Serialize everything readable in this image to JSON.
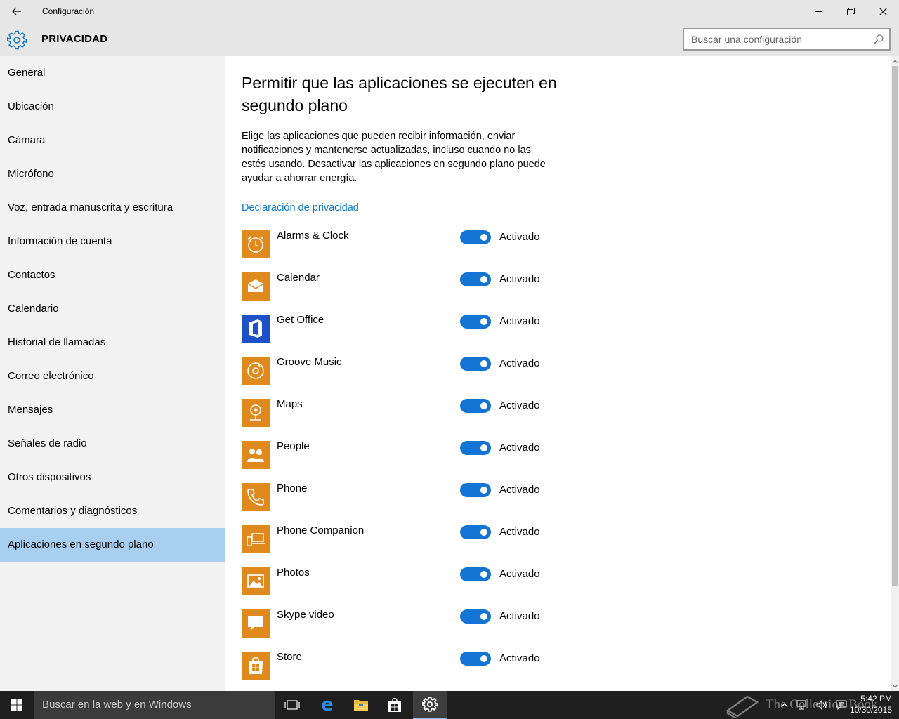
{
  "window": {
    "title": "Configuración"
  },
  "header": {
    "title": "PRIVACIDAD",
    "search_placeholder": "Buscar una configuración"
  },
  "sidebar": {
    "items": [
      {
        "label": "General"
      },
      {
        "label": "Ubicación"
      },
      {
        "label": "Cámara"
      },
      {
        "label": "Micrófono"
      },
      {
        "label": "Voz, entrada manuscrita y escritura"
      },
      {
        "label": "Información de cuenta"
      },
      {
        "label": "Contactos"
      },
      {
        "label": "Calendario"
      },
      {
        "label": "Historial de llamadas"
      },
      {
        "label": "Correo electrónico"
      },
      {
        "label": "Mensajes"
      },
      {
        "label": "Señales de radio"
      },
      {
        "label": "Otros dispositivos"
      },
      {
        "label": "Comentarios y diagnósticos"
      },
      {
        "label": "Aplicaciones en segundo plano",
        "selected": true
      }
    ]
  },
  "main": {
    "title": "Permitir que las aplicaciones se ejecuten en segundo plano",
    "description": "Elige las aplicaciones que pueden recibir información, enviar notificaciones y mantenerse actualizadas, incluso cuando no las estés usando. Desactivar las aplicaciones en segundo plano puede ayudar a ahorrar energía.",
    "privacy_link": "Declaración de privacidad",
    "apps": [
      {
        "name": "Alarms & Clock",
        "state": "Activado",
        "on": true,
        "icon": "alarm-clock-icon"
      },
      {
        "name": "Calendar",
        "state": "Activado",
        "on": true,
        "icon": "calendar-mail-icon"
      },
      {
        "name": "Get Office",
        "state": "Activado",
        "on": true,
        "icon": "office-icon"
      },
      {
        "name": "Groove Music",
        "state": "Activado",
        "on": true,
        "icon": "groove-music-icon"
      },
      {
        "name": "Maps",
        "state": "Activado",
        "on": true,
        "icon": "maps-icon"
      },
      {
        "name": "People",
        "state": "Activado",
        "on": true,
        "icon": "people-icon"
      },
      {
        "name": "Phone",
        "state": "Activado",
        "on": true,
        "icon": "phone-icon"
      },
      {
        "name": "Phone Companion",
        "state": "Activado",
        "on": true,
        "icon": "phone-companion-icon"
      },
      {
        "name": "Photos",
        "state": "Activado",
        "on": true,
        "icon": "photos-icon"
      },
      {
        "name": "Skype video",
        "state": "Activado",
        "on": true,
        "icon": "skype-video-icon"
      },
      {
        "name": "Store",
        "state": "Activado",
        "on": true,
        "icon": "store-icon"
      }
    ]
  },
  "taskbar": {
    "search_placeholder": "Buscar en la web y en Windows",
    "watermark": "The Collection Book",
    "time": "5:42 PM",
    "date": "10/30/2015"
  },
  "colors": {
    "accent": "#1474d4",
    "app_tile": "#e08a1e",
    "office_tile": "#1e50c8",
    "selected_nav": "#a8cff0",
    "link": "#0a78d0"
  }
}
